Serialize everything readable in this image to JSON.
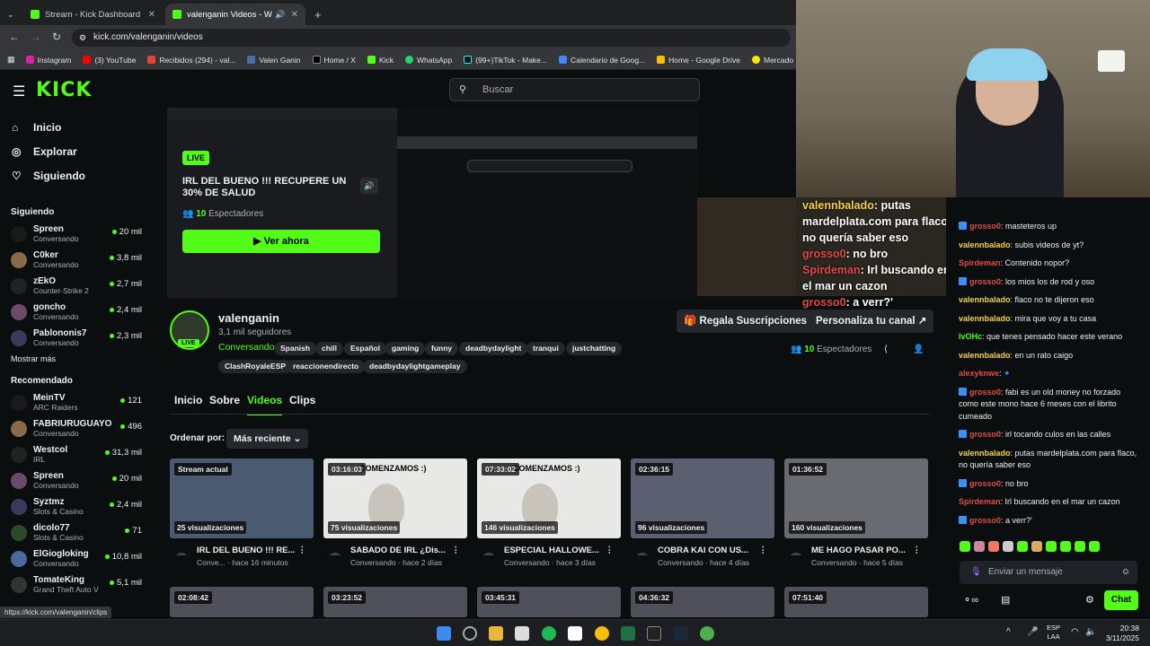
{
  "browser": {
    "tabs": [
      {
        "title": "Stream - Kick Dashboard"
      },
      {
        "title": "valenganin Videos - Watch"
      }
    ],
    "url": "kick.com/valenganin/videos",
    "bookmarks": [
      "Instagram",
      "(3) YouTube",
      "Recibidos (294) - val...",
      "Valen Ganin",
      "Home / X",
      "Kick",
      "WhatsApp",
      "(99+)TikTok - Make...",
      "Calendario de Goog...",
      "Home - Google Drive",
      "Mercado Libre Arg"
    ],
    "status_url": "https://kick.com/valenganin/clips"
  },
  "header": {
    "logo": "KICK",
    "search_placeholder": "Buscar"
  },
  "sidebar": {
    "nav": [
      {
        "label": "Inicio",
        "icon": "home-icon"
      },
      {
        "label": "Explorar",
        "icon": "compass-icon"
      },
      {
        "label": "Siguiendo",
        "icon": "heart-icon"
      }
    ],
    "following_title": "Siguiendo",
    "following": [
      {
        "name": "Spreen",
        "cat": "Conversando",
        "viewers": "20 mil"
      },
      {
        "name": "C0ker",
        "cat": "Conversando",
        "viewers": "3,8 mil"
      },
      {
        "name": "zEkO",
        "cat": "Counter-Strike 2",
        "viewers": "2,7 mil"
      },
      {
        "name": "goncho",
        "cat": "Conversando",
        "viewers": "2,4 mil"
      },
      {
        "name": "Pablononis7",
        "cat": "Conversando",
        "viewers": "2,3 mil"
      }
    ],
    "show_more": "Mostrar más",
    "recommended_title": "Recomendado",
    "recommended": [
      {
        "name": "MeinTV",
        "cat": "ARC Raiders",
        "viewers": "121"
      },
      {
        "name": "FABRIURUGUAYO",
        "cat": "Conversando",
        "viewers": "496"
      },
      {
        "name": "Westcol",
        "cat": "IRL",
        "viewers": "31,3 mil"
      },
      {
        "name": "Spreen",
        "cat": "Conversando",
        "viewers": "20 mil"
      },
      {
        "name": "Syztmz",
        "cat": "Slots & Casino",
        "viewers": "2,4 mil"
      },
      {
        "name": "dicolo77",
        "cat": "Slots & Casino",
        "viewers": "71"
      },
      {
        "name": "ElGiogloking",
        "cat": "Conversando",
        "viewers": "10,8 mil"
      },
      {
        "name": "TomateKing",
        "cat": "Grand Theft Auto V",
        "viewers": "5,1 mil"
      }
    ]
  },
  "player": {
    "live": "LIVE",
    "title": "IRL DEL BUENO !!! RECUPERE UN 30% DE SALUD",
    "viewers_count": "10",
    "viewers_label": "Espectadores",
    "watch": "Ver ahora"
  },
  "overlay_chat": [
    {
      "user": "valennbalado",
      "text": "putas mardelplata.com para flaco, no quería saber eso"
    },
    {
      "user": "grosso0",
      "text": "no bro"
    },
    {
      "user": "Spirdeman",
      "text": "Irl buscando en el mar un cazon"
    },
    {
      "user": "grosso0",
      "text": "a verr?'"
    }
  ],
  "channel": {
    "name": "valenganin",
    "followers": "3,1 mil seguidores",
    "live": "LIVE",
    "category": "Conversando",
    "tags": [
      "Spanish",
      "chill",
      "Español",
      "gaming",
      "funny",
      "deadbydaylight",
      "tranqui",
      "justchatting",
      "ClashRoyaleESP",
      "reaccionendirecto",
      "deadbydaylightgameplay"
    ],
    "gift": "Regala Suscripciones",
    "customize": "Personaliza tu canal",
    "viewers_count": "10",
    "viewers_label": "Espectadores"
  },
  "tabs": [
    "Inicio",
    "Sobre",
    "Videos",
    "Clips"
  ],
  "sort": {
    "label": "Ordenar por:",
    "value": "Más reciente"
  },
  "videos": [
    {
      "badge": "Stream actual",
      "views": "25 visualizaciones",
      "title": "IRL DEL BUENO !!! RE...",
      "meta": "Conve... · hace 16 minutos",
      "color": "#4a5a70"
    },
    {
      "badge": "03:16:03",
      "views": "75 visualizaciones",
      "title": "SABADO DE IRL ¿Dis...",
      "meta": "Conversando · hace 2 días",
      "color": "#e8e8e6",
      "overlay": "COMENZAMOS :)"
    },
    {
      "badge": "07:33:02",
      "views": "146 visualizaciones",
      "title": "ESPECIAL HALLOWE...",
      "meta": "Conversando · hace 3 días",
      "color": "#e8e8e6",
      "overlay": "COMENZAMOS :)"
    },
    {
      "badge": "02:36:15",
      "views": "96 visualizaciones",
      "title": "COBRA KAI CON US...",
      "meta": "Conversando · hace 4 días",
      "color": "#5a6070"
    },
    {
      "badge": "01:36:52",
      "views": "160 visualizaciones",
      "title": "ME HAGO PASAR PO...",
      "meta": "Conversando · hace 5 días",
      "color": "#6a6a72"
    }
  ],
  "videos_row2": [
    "02:08:42",
    "03:23:52",
    "03:45:31",
    "04:36:32",
    "07:51:40"
  ],
  "chat": {
    "messages": [
      {
        "user": "grosso0",
        "color": "#e14a4a",
        "badge": true,
        "text": "masteteros up"
      },
      {
        "user": "valennbalado",
        "color": "#f6d14a",
        "badge": false,
        "text": "subis videos de yt?"
      },
      {
        "user": "Spirdeman",
        "color": "#e14a4a",
        "badge": false,
        "text": "Contenido nopor?"
      },
      {
        "user": "grosso0",
        "color": "#e14a4a",
        "badge": true,
        "text": "los mios los de rod y oso"
      },
      {
        "user": "valennbalado",
        "color": "#f6d14a",
        "badge": false,
        "text": "flaco no te dijeron eso"
      },
      {
        "user": "valennbalado",
        "color": "#f6d14a",
        "badge": false,
        "text": "mira que voy a tu casa"
      },
      {
        "user": "lvOHc",
        "color": "#53fc18",
        "badge": false,
        "text": "que tenes pensado hacer este verano"
      },
      {
        "user": "valennbalado",
        "color": "#f6d14a",
        "badge": false,
        "text": "en un rato caigo"
      },
      {
        "user": "alexyknwe",
        "color": "#e14a4a",
        "badge": false,
        "text": ""
      },
      {
        "user": "grosso0",
        "color": "#e14a4a",
        "badge": true,
        "text": "fabi es un old money no forzado como este mono hace 6 meses con el librito cumeado"
      },
      {
        "user": "grosso0",
        "color": "#e14a4a",
        "badge": true,
        "text": "irl tocando culos en las calles"
      },
      {
        "user": "valennbalado",
        "color": "#f6d14a",
        "badge": false,
        "text": "putas mardelplata.com para flaco, no quería saber eso"
      },
      {
        "user": "grosso0",
        "color": "#e14a4a",
        "badge": true,
        "text": "no bro"
      },
      {
        "user": "Spirdeman",
        "color": "#e14a4a",
        "badge": false,
        "text": "Irl buscando en el mar un cazon"
      },
      {
        "user": "grosso0",
        "color": "#e14a4a",
        "badge": true,
        "text": "a verr?'"
      }
    ],
    "input_placeholder": "Enviar un mensaje",
    "send": "Chat"
  },
  "taskbar": {
    "lang1": "ESP",
    "lang2": "LAA",
    "time": "20:38",
    "date": "3/11/2025"
  }
}
